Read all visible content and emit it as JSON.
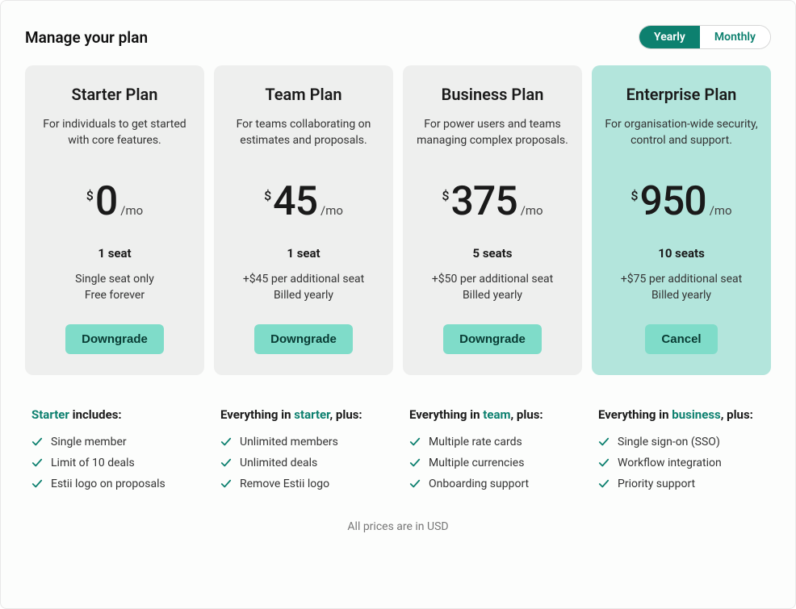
{
  "header": {
    "title": "Manage your plan",
    "toggle": {
      "yearly": "Yearly",
      "monthly": "Monthly",
      "active": "Yearly"
    }
  },
  "currency": "$",
  "per": "/mo",
  "plans": [
    {
      "name": "Starter Plan",
      "desc": "For individuals to get started with core features.",
      "price": "0",
      "seats": "1 seat",
      "extra1": "Single seat only",
      "extra2": "Free forever",
      "action": "Downgrade",
      "current": false
    },
    {
      "name": "Team Plan",
      "desc": "For teams collaborating on estimates and proposals.",
      "price": "45",
      "seats": "1 seat",
      "extra1": "+$45 per additional seat",
      "extra2": "Billed yearly",
      "action": "Downgrade",
      "current": false
    },
    {
      "name": "Business Plan",
      "desc": "For power users and teams managing complex proposals.",
      "price": "375",
      "seats": "5 seats",
      "extra1": "+$50 per additional seat",
      "extra2": "Billed yearly",
      "action": "Downgrade",
      "current": false
    },
    {
      "name": "Enterprise Plan",
      "desc": "For organisation-wide security, control and support.",
      "price": "950",
      "seats": "10 seats",
      "extra1": "+$75 per additional seat",
      "extra2": "Billed yearly",
      "action": "Cancel",
      "current": true
    }
  ],
  "features": [
    {
      "title_pre": "",
      "title_accent": "Starter",
      "title_post": " includes:",
      "items": [
        "Single member",
        "Limit of 10 deals",
        "Estii logo on proposals"
      ]
    },
    {
      "title_pre": "Everything in ",
      "title_accent": "starter",
      "title_post": ", plus:",
      "items": [
        "Unlimited members",
        "Unlimited deals",
        "Remove Estii logo"
      ]
    },
    {
      "title_pre": "Everything in ",
      "title_accent": "team",
      "title_post": ", plus:",
      "items": [
        "Multiple rate cards",
        "Multiple currencies",
        "Onboarding support"
      ]
    },
    {
      "title_pre": "Everything in ",
      "title_accent": "business",
      "title_post": ", plus:",
      "items": [
        "Single sign-on (SSO)",
        "Workflow integration",
        "Priority support"
      ]
    }
  ],
  "footer": "All prices are in USD"
}
